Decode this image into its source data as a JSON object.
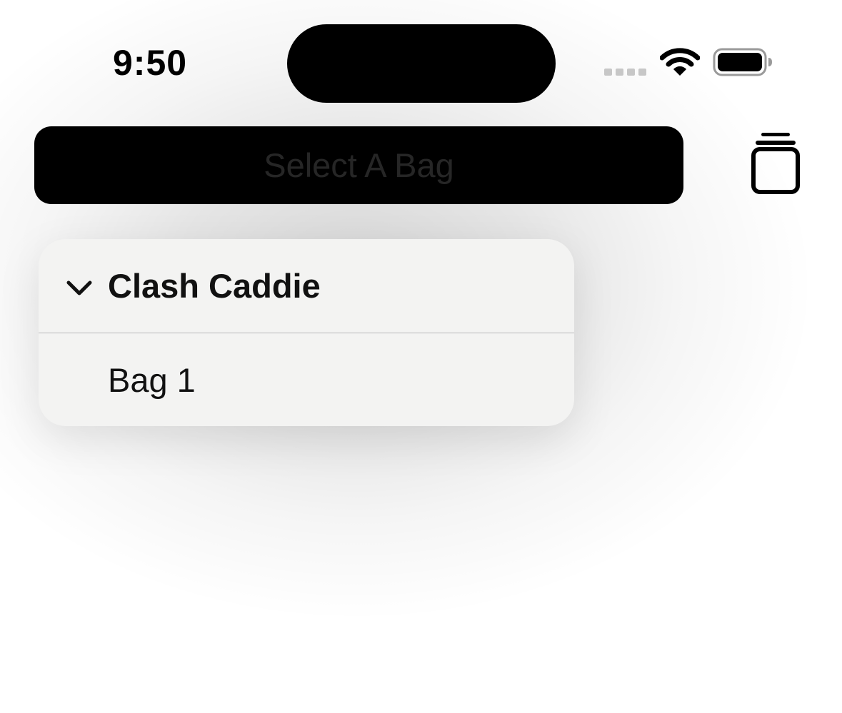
{
  "status_bar": {
    "time": "9:50",
    "icons": [
      "cellular-signal-icon",
      "wifi-icon",
      "battery-icon"
    ]
  },
  "toolbar": {
    "select_bag_label": "Select A Bag",
    "trash_icon": "trash-icon"
  },
  "menu": {
    "section_title": "Clash Caddie",
    "section_icon": "chevron-down-icon",
    "items": [
      {
        "label": "Bag 1"
      }
    ]
  },
  "colors": {
    "select_bar_bg": "#000000",
    "select_label": "#262626",
    "menu_bg": "#f3f3f2",
    "text": "#111111"
  }
}
